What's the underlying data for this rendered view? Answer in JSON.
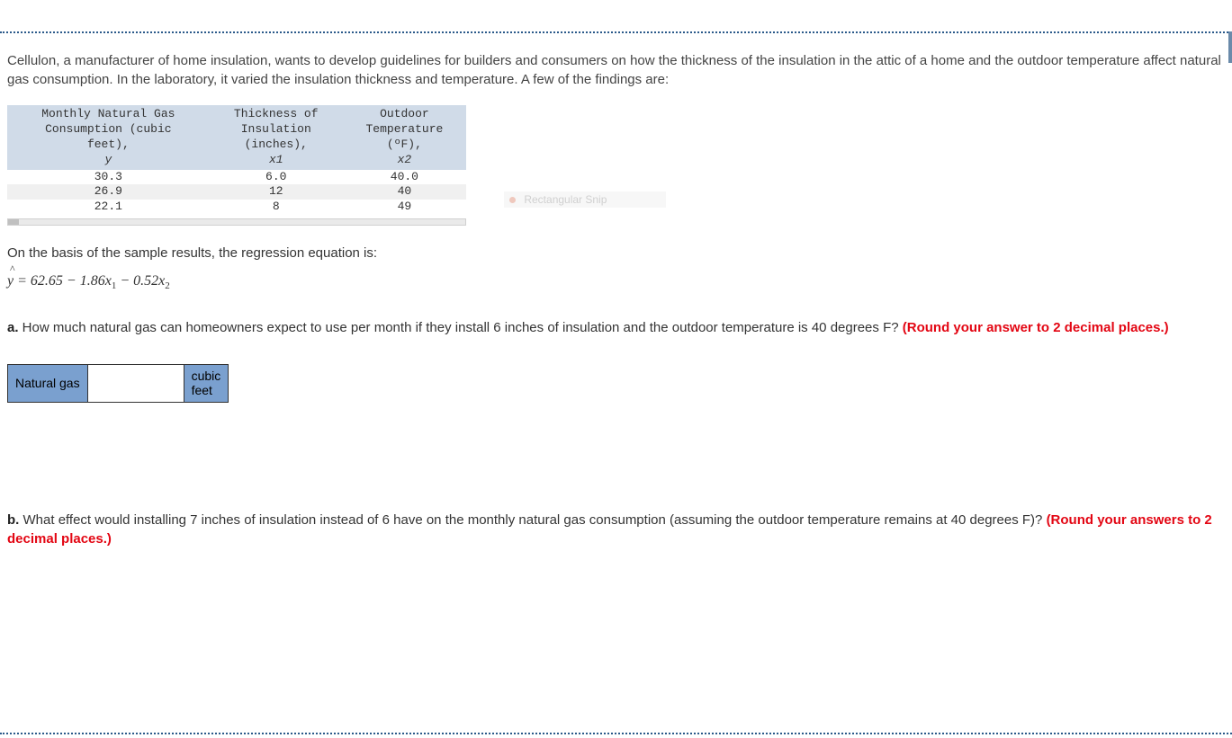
{
  "intro": "Cellulon, a manufacturer of home insulation, wants to develop guidelines for builders and consumers on how the thickness of the insulation in the attic of a home and the outdoor temperature affect natural gas consumption. In the laboratory, it varied the insulation thickness and temperature. A few of the findings are:",
  "snip_label": "Rectangular Snip",
  "table": {
    "headers": {
      "c1a": "Monthly Natural Gas",
      "c1b": "Consumption (cubic",
      "c1c": "feet),",
      "c1v": "y",
      "c2a": "Thickness of",
      "c2b": "Insulation",
      "c2c": "(inches),",
      "c2v": "x1",
      "c3a": "Outdoor",
      "c3b": "Temperature",
      "c3c": "(ºF),",
      "c3v": "x2"
    },
    "rows": [
      {
        "y": "30.3",
        "x1": "6.0",
        "x2": "40.0"
      },
      {
        "y": "26.9",
        "x1": "12",
        "x2": "40"
      },
      {
        "y": "22.1",
        "x1": "8",
        "x2": "49"
      }
    ]
  },
  "regression_intro": "On the basis of the sample results, the regression equation is:",
  "equation": {
    "lhs": "y",
    "eq": " = 62.65 − 1.86",
    "x1": "x",
    "s1": "1",
    "mid": " − 0.52",
    "x2": "x",
    "s2": "2"
  },
  "qa": {
    "label": "a.",
    "text": " How much natural gas can homeowners expect to use per month if they install 6 inches of insulation and the outdoor temperature is 40 degrees F? ",
    "round": "(Round your answer to 2 decimal places.)"
  },
  "answer_box": {
    "label": "Natural gas",
    "unit1": "cubic",
    "unit2": "feet",
    "value": ""
  },
  "qb": {
    "label": "b.",
    "text": " What effect would installing 7 inches of insulation instead of 6 have on the monthly natural gas consumption (assuming the outdoor temperature remains at 40 degrees F)? ",
    "round": "(Round your answers to 2 decimal places.)"
  }
}
